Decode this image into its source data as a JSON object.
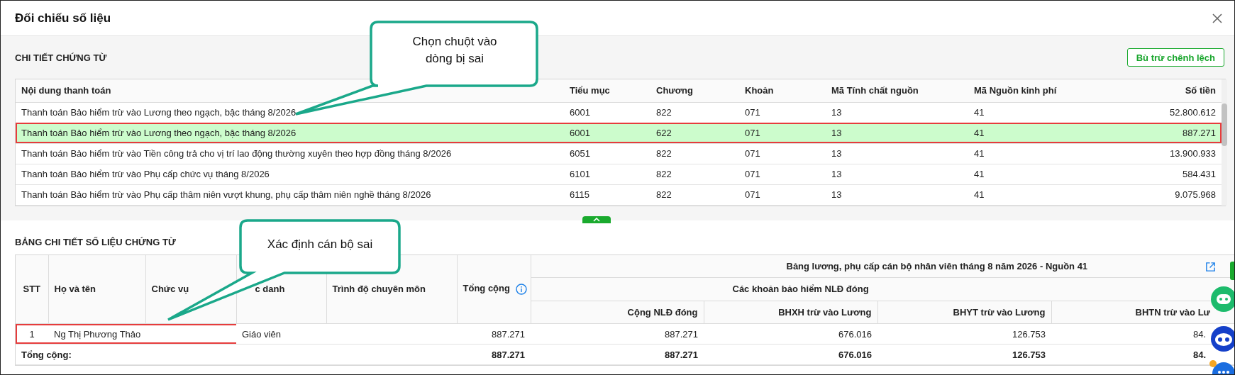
{
  "dialog": {
    "title": "Đối chiếu số liệu"
  },
  "voucher_section": {
    "title": "CHI TIẾT CHỨNG TỪ",
    "button": "Bù trừ chênh lệch",
    "columns": [
      "Nội dung thanh toán",
      "Tiểu mục",
      "Chương",
      "Khoản",
      "Mã Tính chất nguồn",
      "Mã Nguồn kinh phí",
      "Số tiền"
    ],
    "rows": [
      {
        "cells": [
          "Thanh toán Bảo hiểm trừ vào Lương theo ngạch, bậc tháng 8/2026",
          "6001",
          "822",
          "071",
          "13",
          "41",
          "52.800.612"
        ],
        "selected": false
      },
      {
        "cells": [
          "Thanh toán Bảo hiểm trừ vào Lương theo ngạch, bậc tháng 8/2026",
          "6001",
          "622",
          "071",
          "13",
          "41",
          "887.271"
        ],
        "selected": true
      },
      {
        "cells": [
          "Thanh toán Bảo hiểm trừ vào Tiền công trả cho vị trí lao động thường xuyên theo hợp đồng tháng 8/2026",
          "6051",
          "822",
          "071",
          "13",
          "41",
          "13.900.933"
        ],
        "selected": false
      },
      {
        "cells": [
          "Thanh toán Bảo hiểm trừ vào Phụ cấp chức vụ tháng 8/2026",
          "6101",
          "822",
          "071",
          "13",
          "41",
          "584.431"
        ],
        "selected": false
      },
      {
        "cells": [
          "Thanh toán Bảo hiểm trừ vào Phụ cấp thâm niên vượt khung, phụ cấp thâm niên nghề tháng 8/2026",
          "6115",
          "822",
          "071",
          "13",
          "41",
          "9.075.968"
        ],
        "selected": false
      }
    ]
  },
  "detail_section": {
    "title": "BẢNG CHI TIẾT SỐ LIỆU CHỨNG TỪ",
    "group_header": "Bảng lương, phụ cấp cán bộ nhân viên tháng 8 năm 2026 - Nguồn 41",
    "subgroup_header": "Các khoản bảo hiểm NLĐ đóng",
    "fixed_columns": [
      "STT",
      "Họ và tên",
      "Chức vụ",
      "c danh",
      "Trình độ chuyên môn",
      "Tổng cộng"
    ],
    "group_columns": [
      "Cộng NLĐ đóng",
      "BHXH trừ vào Lương",
      "BHYT trừ vào Lương",
      "BHTN trừ vào Lư"
    ],
    "rows": [
      {
        "stt": "1",
        "name": "Ng Thị Phương Thảo",
        "job_title": "Giáo viên",
        "total": "887.271",
        "nld": "887.271",
        "bhxh": "676.016",
        "bhyt": "126.753",
        "bhtn": "84.",
        "highlighted": true
      }
    ],
    "total_row": {
      "label": "Tổng cộng:",
      "total": "887.271",
      "nld": "887.271",
      "bhxh": "676.016",
      "bhyt": "126.753",
      "bhtn": "84."
    }
  },
  "callouts": [
    {
      "text": "Chọn chuột vào dòng bị sai"
    },
    {
      "text": "Xác định cán bộ sai"
    }
  ]
}
